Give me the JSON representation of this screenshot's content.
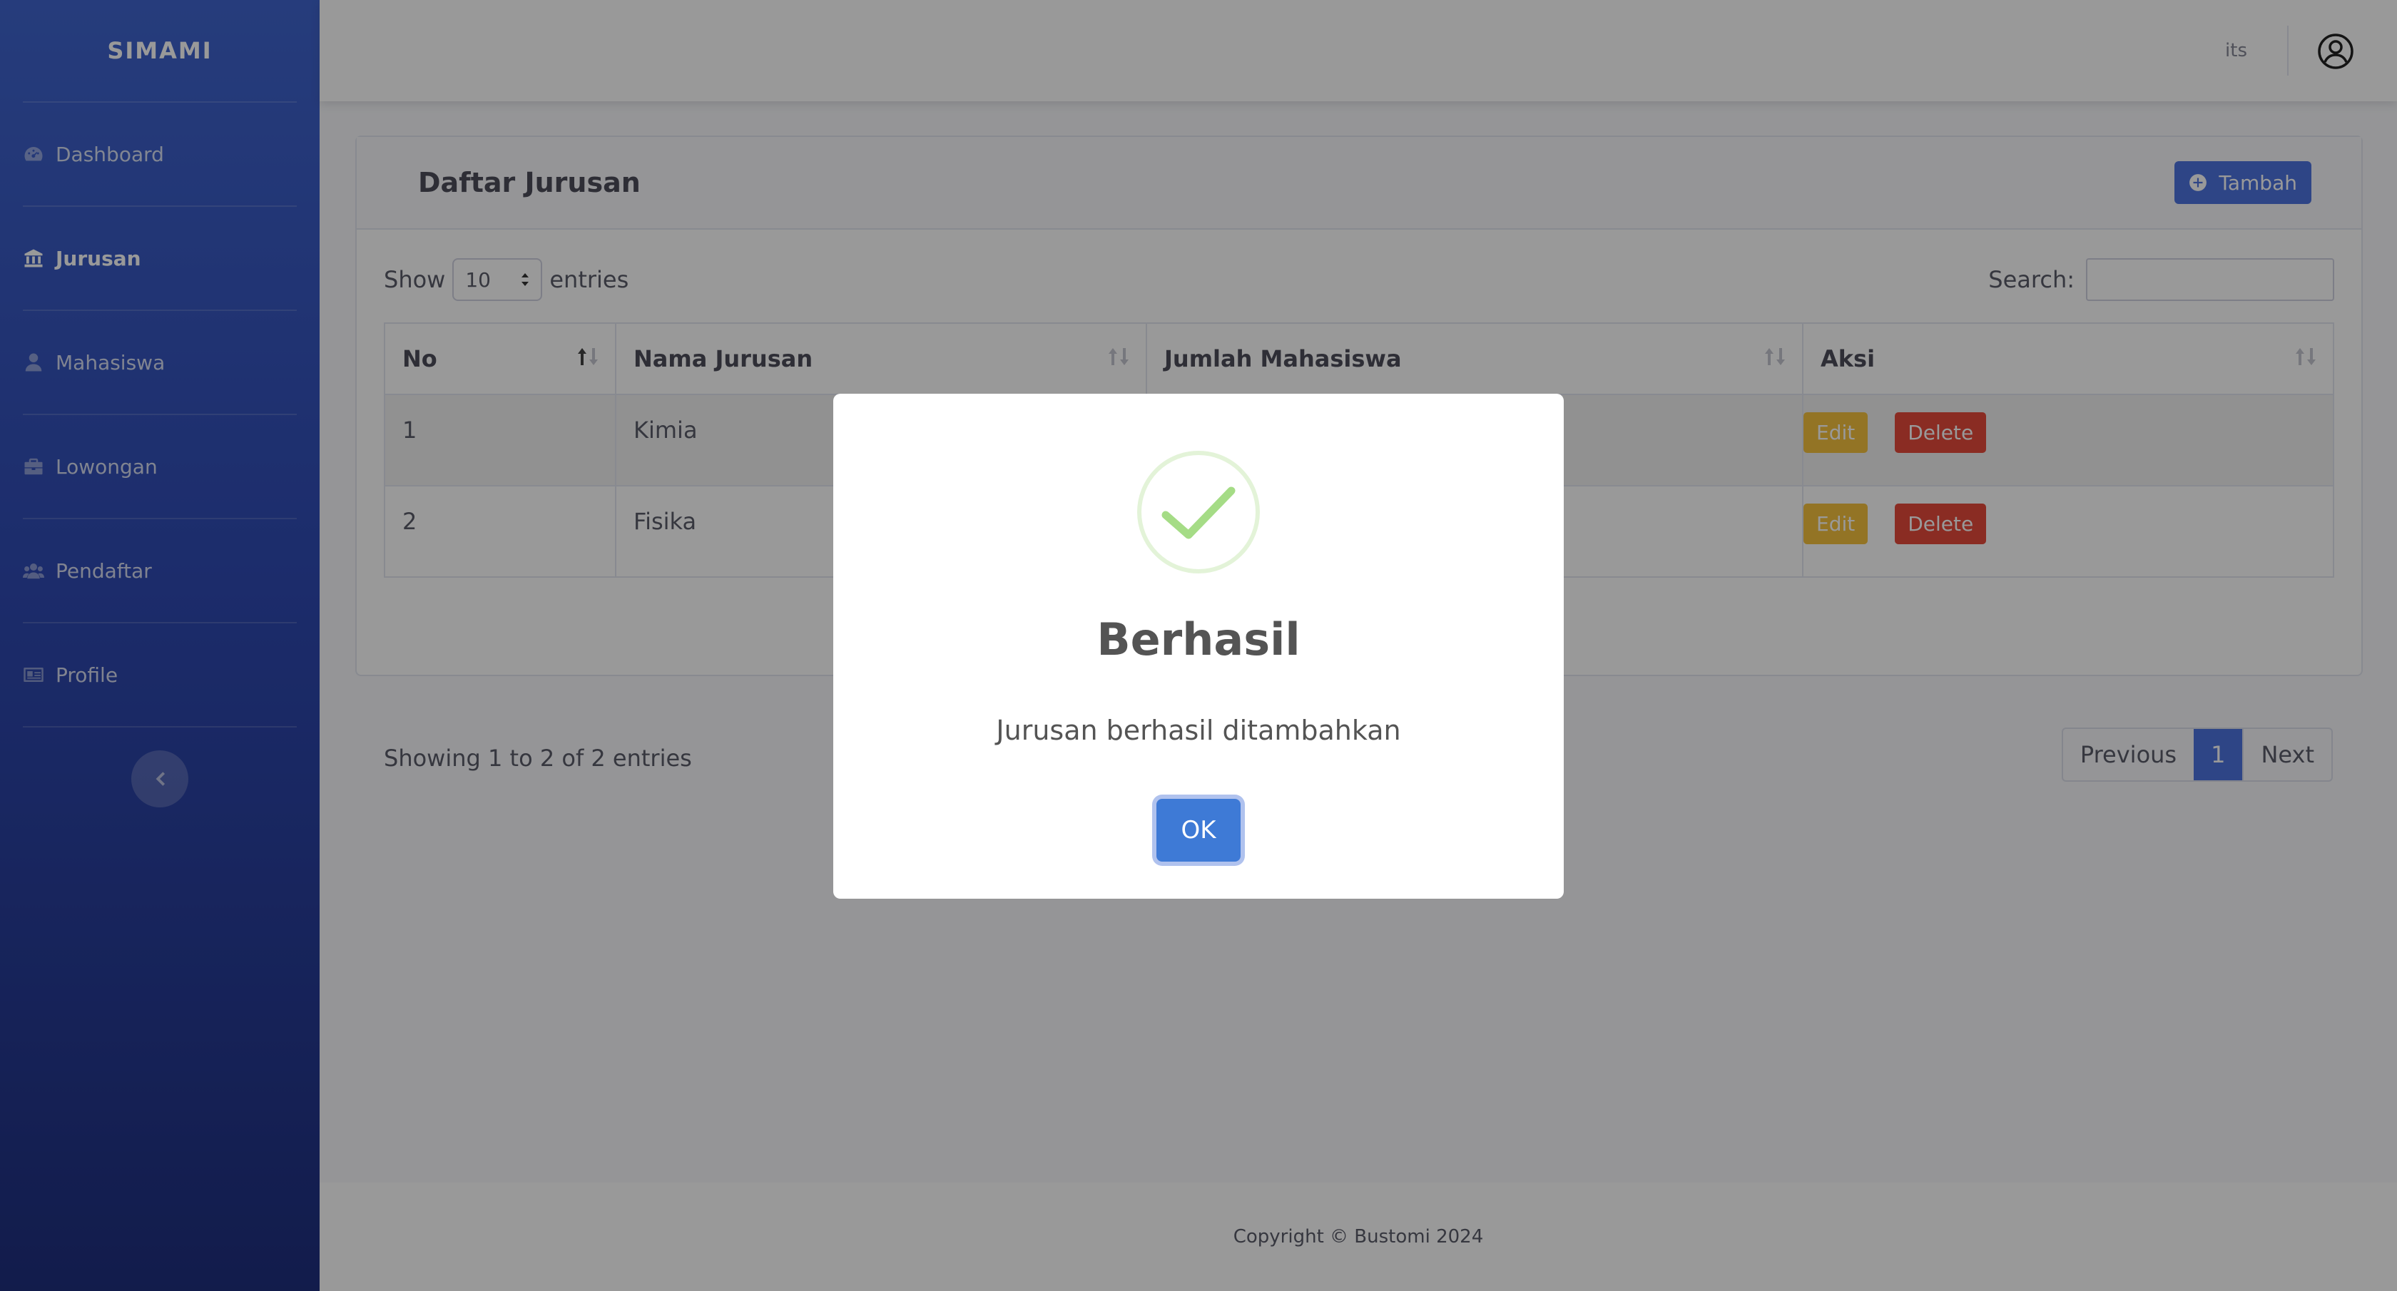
{
  "brand": "SIMAMI",
  "sidebar": {
    "items": [
      {
        "label": "Dashboard",
        "icon": "dashboard-icon",
        "active": false
      },
      {
        "label": "Jurusan",
        "icon": "university-icon",
        "active": true
      },
      {
        "label": "Mahasiswa",
        "icon": "user-icon",
        "active": false
      },
      {
        "label": "Lowongan",
        "icon": "briefcase-icon",
        "active": false
      },
      {
        "label": "Pendaftar",
        "icon": "users-icon",
        "active": false
      },
      {
        "label": "Profile",
        "icon": "id-card-icon",
        "active": false
      }
    ]
  },
  "topbar": {
    "user": "its"
  },
  "card": {
    "title": "Daftar Jurusan",
    "add_label": "Tambah",
    "show_label": "Show",
    "entries_value": "10",
    "entries_label": "entries",
    "search_label": "Search:",
    "search_value": ""
  },
  "table": {
    "headers": [
      "No",
      "Nama Jurusan",
      "Jumlah Mahasiswa",
      "Aksi"
    ],
    "rows": [
      {
        "no": "1",
        "nama": "Kimia",
        "jumlah": "",
        "edit": "Edit",
        "delete": "Delete"
      },
      {
        "no": "2",
        "nama": "Fisika",
        "jumlah": "",
        "edit": "Edit",
        "delete": "Delete"
      }
    ]
  },
  "info": "Showing 1 to 2 of 2 entries",
  "pagination": {
    "previous": "Previous",
    "current": "1",
    "next": "Next"
  },
  "footer": "Copyright © Bustomi 2024",
  "modal": {
    "title": "Berhasil",
    "text": "Jurusan berhasil ditambahkan",
    "ok": "OK",
    "icon": "success-check-icon"
  },
  "colors": {
    "primary": "#4e73df",
    "warning": "#f6c23e",
    "danger": "#e74a3b",
    "success": "#a5dc86"
  }
}
